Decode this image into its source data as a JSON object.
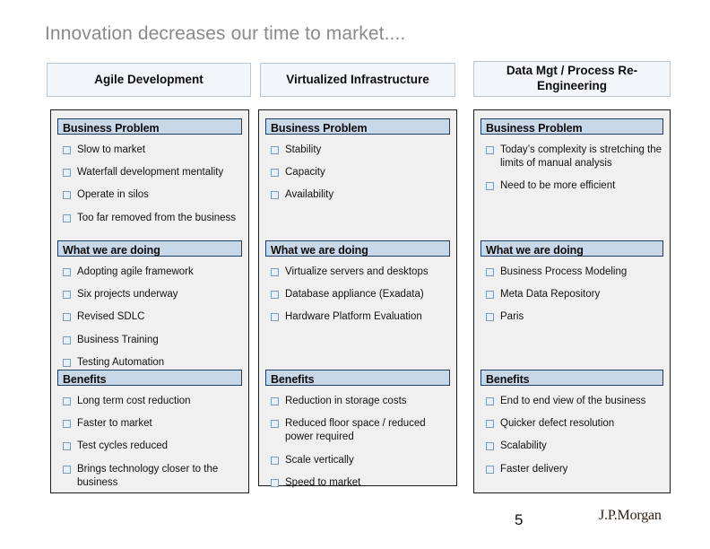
{
  "slide": {
    "title": "Innovation decreases our time to market....",
    "page_number": "5",
    "brand": "J.P.Morgan",
    "title_color": "#8a8a8a",
    "section_header_fill": "#c9d8e8",
    "section_header_border": "#1f3f66",
    "column_header_fill": "#f2f6fa",
    "column_body_fill": "#f0f0f0",
    "bullet_marker": "hollow-square"
  },
  "columns": [
    {
      "header": "Agile Development",
      "sections": [
        {
          "title": "Business Problem",
          "bullets": [
            "Slow to market",
            "Waterfall development mentality",
            "Operate in silos",
            "Too far removed from the business"
          ]
        },
        {
          "title": "What we are doing",
          "bullets": [
            "Adopting agile framework",
            "Six projects underway",
            "Revised SDLC",
            "Business Training",
            "Testing Automation"
          ]
        },
        {
          "title": "Benefits",
          "bullets": [
            "Long term cost reduction",
            "Faster to market",
            "Test cycles reduced",
            "Brings technology closer to the business"
          ]
        }
      ]
    },
    {
      "header": "Virtualized Infrastructure",
      "sections": [
        {
          "title": "Business Problem",
          "bullets": [
            "Stability",
            "Capacity",
            "Availability"
          ]
        },
        {
          "title": "What we are doing",
          "bullets": [
            "Virtualize servers and desktops",
            "Database appliance (Exadata)",
            "Hardware Platform Evaluation"
          ]
        },
        {
          "title": "Benefits",
          "bullets": [
            "Reduction in storage costs",
            "Reduced floor space / reduced power required",
            "Scale vertically",
            "Speed to market"
          ]
        }
      ]
    },
    {
      "header": "Data Mgt / Process Re-Engineering",
      "sections": [
        {
          "title": "Business Problem",
          "bullets": [
            "Today’s complexity  is stretching the limits of manual analysis",
            "Need to be more efficient"
          ]
        },
        {
          "title": "What we are doing",
          "bullets": [
            "Business Process Modeling",
            "Meta Data Repository",
            "Paris"
          ]
        },
        {
          "title": "Benefits",
          "bullets": [
            "End to end view of the business",
            "Quicker defect resolution",
            "Scalability",
            "Faster delivery"
          ]
        }
      ]
    }
  ]
}
